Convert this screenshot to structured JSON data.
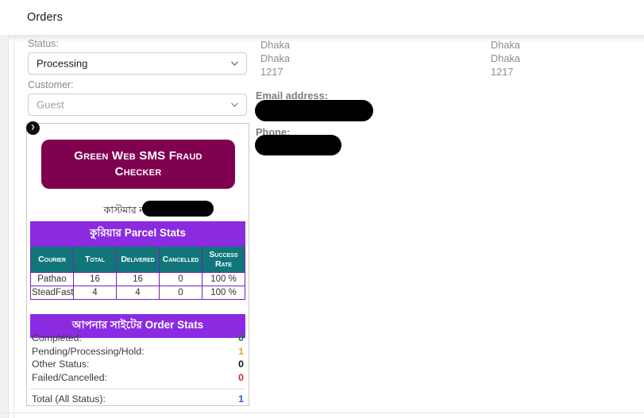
{
  "window": {
    "title": "Orders"
  },
  "form": {
    "status": {
      "label": "Status:",
      "value": "Processing",
      "icon": "chevron-down-icon"
    },
    "customer": {
      "label": "Customer:",
      "placeholder": "Guest",
      "value": "Guest",
      "icon": "chevron-down-icon"
    }
  },
  "billing": {
    "city": "Dhaka",
    "state": "Dhaka",
    "postcode": "1217",
    "email_label": "Email address:",
    "email_value": "",
    "phone_label": "Phone:",
    "phone_value": ""
  },
  "shipping": {
    "city": "Dhaka",
    "state": "Dhaka",
    "postcode": "1217"
  },
  "fraud_panel": {
    "toggle_icon": "chevron-right-icon",
    "brand_title": "Green Web SMS Fraud Checker",
    "customer_number_label": "কাস্টমার নাম্বার: +",
    "customer_number_value": "",
    "parcel_stats": {
      "title": "কুরিয়ার Parcel Stats",
      "columns": [
        "Courier",
        "Total",
        "Delivered",
        "Cancelled",
        "Success Rate"
      ],
      "rows": [
        {
          "courier": "Pathao",
          "total": "16",
          "delivered": "16",
          "cancelled": "0",
          "rate": "100 %"
        },
        {
          "courier": "SteadFast",
          "total": "4",
          "delivered": "4",
          "cancelled": "0",
          "rate": "100 %"
        }
      ]
    },
    "order_stats": {
      "title": "আপনার সাইটের Order Stats",
      "rows": [
        {
          "label": "Completed:",
          "value": "0",
          "color": "#1f7a1f"
        },
        {
          "label": "Pending/Processing/Hold:",
          "value": "1",
          "color": "#e0a040"
        },
        {
          "label": "Other Status:",
          "value": "0",
          "color": "#111111"
        },
        {
          "label": "Failed/Cancelled:",
          "value": "0",
          "color": "#e02020"
        }
      ],
      "total": {
        "label": "Total (All Status):",
        "value": "1",
        "color": "#2a5fd6"
      }
    }
  },
  "colors": {
    "brand_purple": "#800050",
    "band_violet": "#8a2be2",
    "table_header_teal": "#11767a"
  }
}
